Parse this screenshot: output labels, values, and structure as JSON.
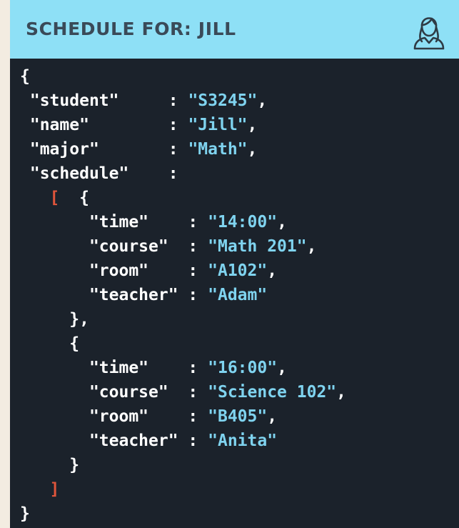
{
  "header": {
    "title": "SCHEDULE FOR: JILL",
    "icon": "user-avatar-icon",
    "background": "#8ee0f6"
  },
  "colors": {
    "panel": "#1b222b",
    "key": "#ffffff",
    "value": "#7fd3ef",
    "bracket": "#e0553b"
  },
  "json_view": {
    "student": {
      "key": "\"student\"",
      "value": "\"S3245\""
    },
    "name": {
      "key": "\"name\"",
      "value": "\"Jill\""
    },
    "major": {
      "key": "\"major\"",
      "value": "\"Math\""
    },
    "schedule": {
      "key": "\"schedule\"",
      "items": [
        {
          "time": {
            "key": "\"time\"",
            "value": "\"14:00\""
          },
          "course": {
            "key": "\"course\"",
            "value": "\"Math 201\""
          },
          "room": {
            "key": "\"room\"",
            "value": "\"A102\""
          },
          "teacher": {
            "key": "\"teacher\"",
            "value": "\"Adam\""
          }
        },
        {
          "time": {
            "key": "\"time\"",
            "value": "\"16:00\""
          },
          "course": {
            "key": "\"course\"",
            "value": "\"Science 102\""
          },
          "room": {
            "key": "\"room\"",
            "value": "\"B405\""
          },
          "teacher": {
            "key": "\"teacher\"",
            "value": "\"Anita\""
          }
        }
      ]
    }
  }
}
